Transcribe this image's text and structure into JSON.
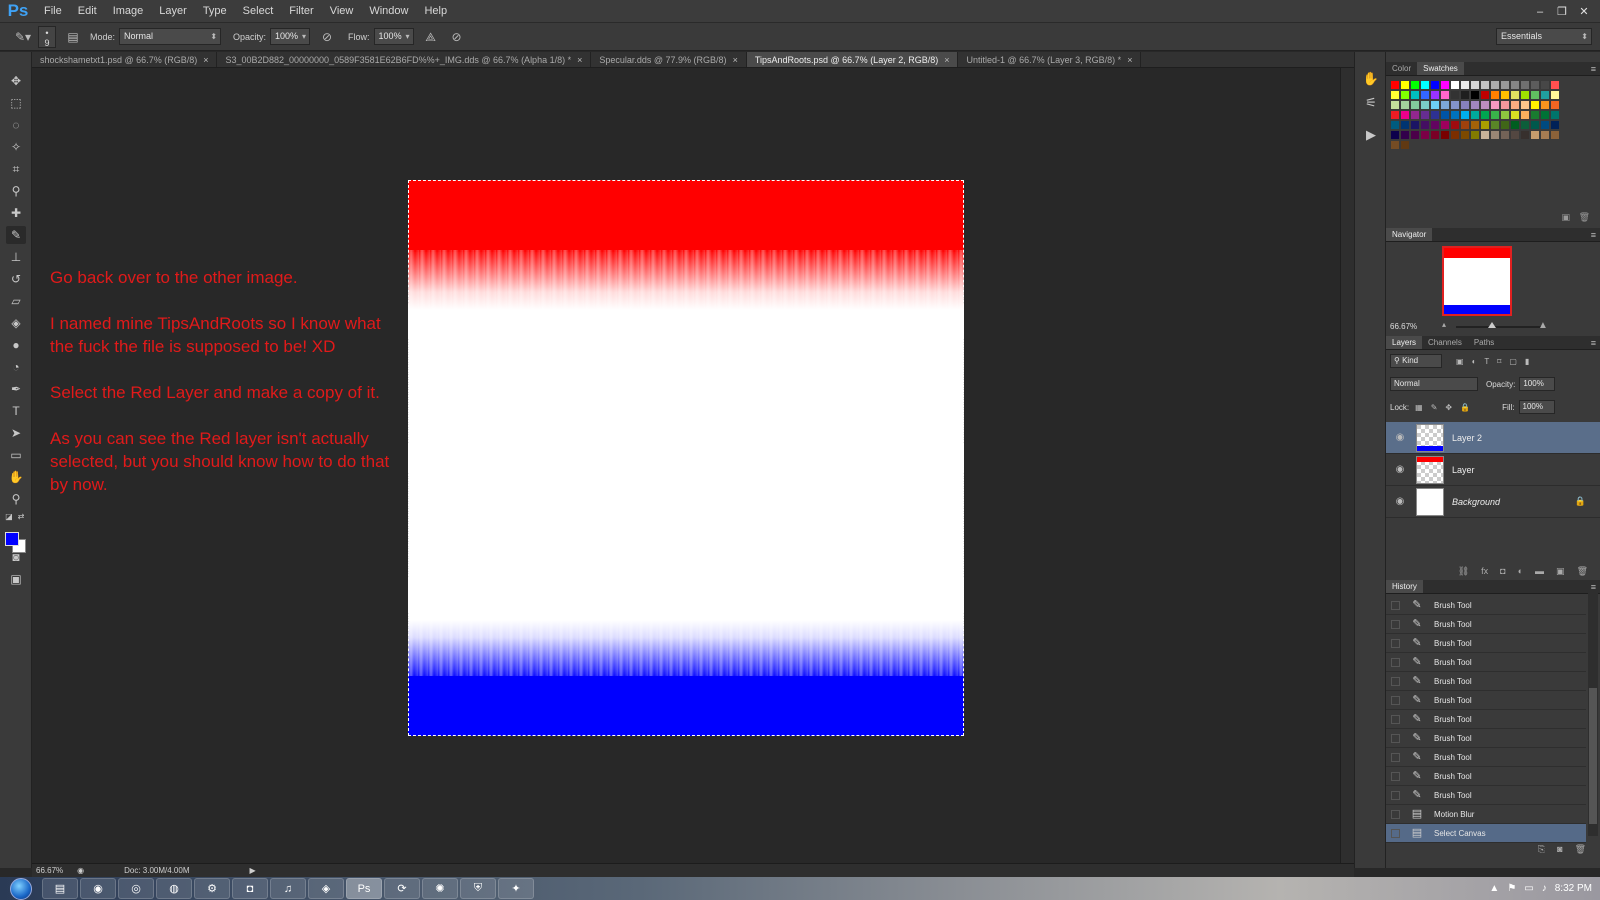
{
  "app": {
    "logo": "Ps"
  },
  "menu": [
    "File",
    "Edit",
    "Image",
    "Layer",
    "Type",
    "Select",
    "Filter",
    "View",
    "Window",
    "Help"
  ],
  "window_controls": {
    "minimize": "–",
    "restore": "❐",
    "close": "✕"
  },
  "options_bar": {
    "brush_size": "9",
    "mode_label": "Mode:",
    "mode_value": "Normal",
    "opacity_label": "Opacity:",
    "opacity_value": "100%",
    "flow_label": "Flow:",
    "flow_value": "100%",
    "workspace": "Essentials"
  },
  "tabs": [
    {
      "label": "shockshametxt1.psd @ 66.7% (RGB/8)",
      "active": false
    },
    {
      "label": "S3_00B2D882_00000000_0589F3581E62B6FD%%+_IMG.dds @ 66.7% (Alpha 1/8) *",
      "active": false
    },
    {
      "label": "Specular.dds @ 77.9% (RGB/8)",
      "active": false
    },
    {
      "label": "TipsAndRoots.psd @ 66.7% (Layer 2, RGB/8)",
      "active": true
    },
    {
      "label": "Untitled-1 @ 66.7% (Layer 3, RGB/8) *",
      "active": false
    }
  ],
  "instructions": {
    "p1": "Go back over to the other image.",
    "p2": "I named mine TipsAndRoots so I know what the fuck the file is supposed to be! XD",
    "p3": "Select the Red Layer and make a copy of it.",
    "p4": "As you can see the Red layer isn't actually selected, but you should know how to do that by now."
  },
  "status": {
    "zoom": "66.67%",
    "doc": "Doc: 3.00M/4.00M"
  },
  "colors": {
    "foreground": "#0000ff",
    "background": "#ffffff",
    "red": "#ff0000",
    "blue": "#0000ff",
    "instruction_text": "#e11a1a"
  },
  "color_panel": {
    "tabs": [
      "Color",
      "Swatches"
    ],
    "active": "Swatches"
  },
  "navigator": {
    "title": "Navigator",
    "zoom": "66.67%"
  },
  "layers_panel": {
    "tabs": [
      "Layers",
      "Channels",
      "Paths"
    ],
    "filter": "Kind",
    "blend_mode": "Normal",
    "opacity_label": "Opacity:",
    "opacity_value": "100%",
    "lock_label": "Lock:",
    "fill_label": "Fill:",
    "fill_value": "100%",
    "layers": [
      {
        "name": "Layer 2",
        "selected": true
      },
      {
        "name": "Layer",
        "selected": false
      },
      {
        "name": "Background",
        "selected": false
      }
    ]
  },
  "history_panel": {
    "title": "History",
    "items": [
      {
        "name": "Brush Tool",
        "icon": "brush-icon",
        "selected": false
      },
      {
        "name": "Brush Tool",
        "icon": "brush-icon",
        "selected": false
      },
      {
        "name": "Brush Tool",
        "icon": "brush-icon",
        "selected": false
      },
      {
        "name": "Brush Tool",
        "icon": "brush-icon",
        "selected": false
      },
      {
        "name": "Brush Tool",
        "icon": "brush-icon",
        "selected": false
      },
      {
        "name": "Brush Tool",
        "icon": "brush-icon",
        "selected": false
      },
      {
        "name": "Brush Tool",
        "icon": "brush-icon",
        "selected": false
      },
      {
        "name": "Brush Tool",
        "icon": "brush-icon",
        "selected": false
      },
      {
        "name": "Brush Tool",
        "icon": "brush-icon",
        "selected": false
      },
      {
        "name": "Brush Tool",
        "icon": "brush-icon",
        "selected": false
      },
      {
        "name": "Brush Tool",
        "icon": "brush-icon",
        "selected": false
      },
      {
        "name": "Motion Blur",
        "icon": "filter-icon",
        "selected": false
      },
      {
        "name": "Select Canvas",
        "icon": "selection-icon",
        "selected": true
      }
    ]
  },
  "taskbar": {
    "time": "8:32 PM"
  },
  "swatch_colors": [
    "#ff0000",
    "#ffff00",
    "#00ff00",
    "#00ffff",
    "#0000ff",
    "#ff00ff",
    "#ffffff",
    "#ebebeb",
    "#d6d6d6",
    "#c2c2c2",
    "#adadad",
    "#999999",
    "#858585",
    "#707070",
    "#5c5c5c",
    "#474747",
    "#ff5050",
    "#ffff33",
    "#80ff00",
    "#00c0c0",
    "#3366ff",
    "#9933ff",
    "#ff66cc",
    "#333333",
    "#1f1f1f",
    "#000000",
    "#c00000",
    "#ff8000",
    "#ffc000",
    "#e0e060",
    "#a0e000",
    "#60c060",
    "#20a0a0",
    "#fff799",
    "#c4df9b",
    "#a3d39c",
    "#82ca9c",
    "#7accc8",
    "#6dcff6",
    "#7da7d9",
    "#8393ca",
    "#8781bd",
    "#a186be",
    "#bc8dbf",
    "#f49ac1",
    "#f5989d",
    "#f9ad81",
    "#fdc68a",
    "#fff200",
    "#f7941d",
    "#f26522",
    "#ed1c24",
    "#ec008c",
    "#92278f",
    "#662d91",
    "#2e3192",
    "#0054a6",
    "#0072bc",
    "#00aeef",
    "#00a99d",
    "#00a651",
    "#39b54a",
    "#8dc63f",
    "#d7df23",
    "#fbaf5d",
    "#197b30",
    "#007236",
    "#00746b",
    "#005b7f",
    "#003471",
    "#1b1464",
    "#440e62",
    "#630460",
    "#9e005d",
    "#9e0b0f",
    "#a0410d",
    "#a36209",
    "#aba000",
    "#598527",
    "#406618",
    "#005e20",
    "#0d5e3a",
    "#00584c",
    "#004a80",
    "#002157",
    "#0d004c",
    "#32004b",
    "#4b0049",
    "#7b0046",
    "#7a0026",
    "#790000",
    "#7b2e00",
    "#7d4900",
    "#827b00",
    "#c7b299",
    "#998675",
    "#736357",
    "#534741",
    "#37302d",
    "#c69c6d",
    "#a67c52",
    "#8c6239",
    "#754c24",
    "#603913"
  ]
}
